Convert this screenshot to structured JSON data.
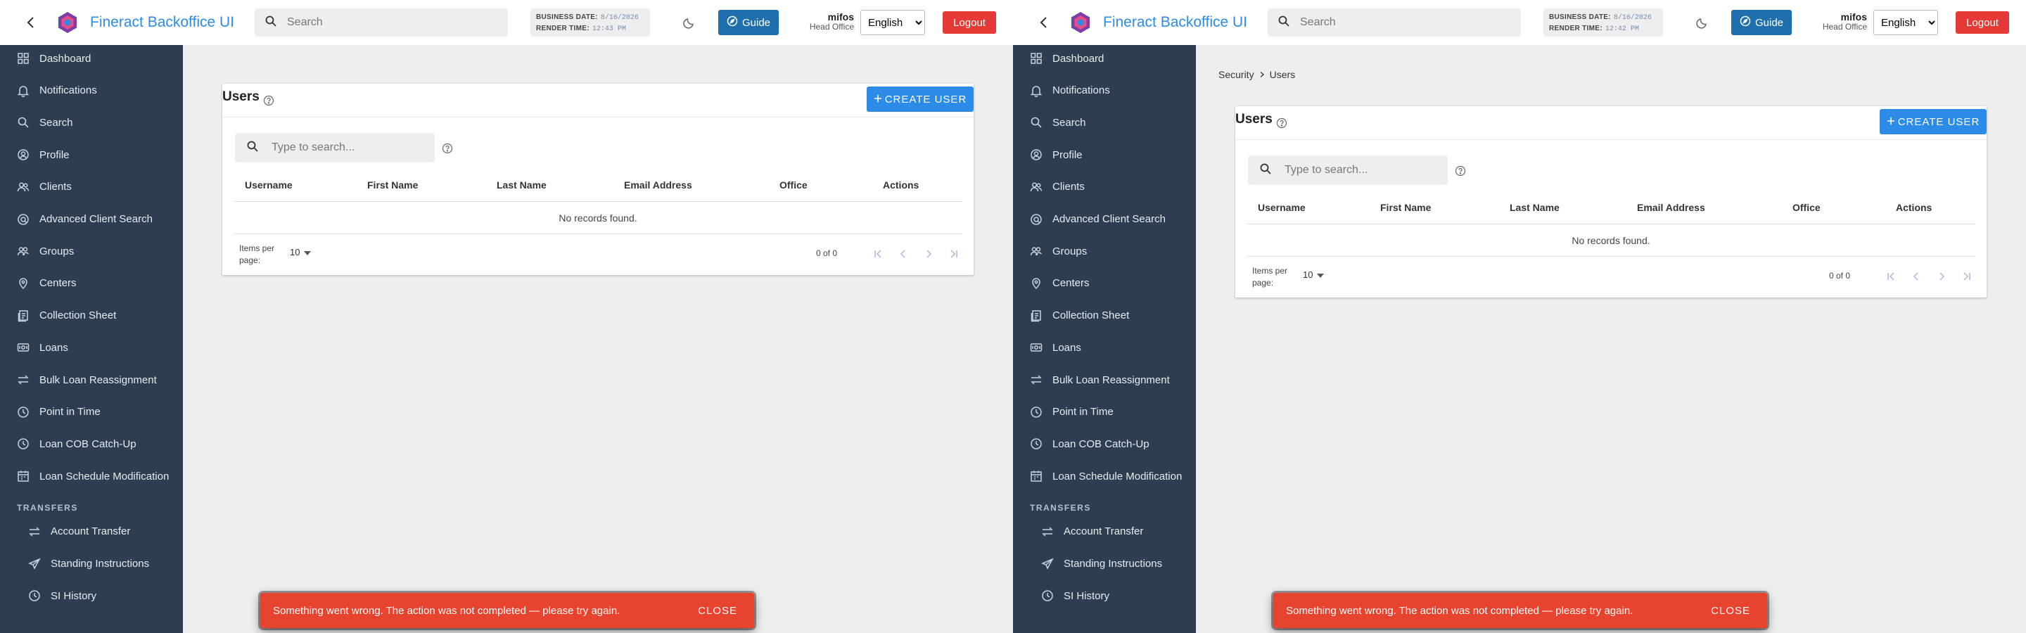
{
  "panes": [
    {
      "topbar": {
        "title": "Fineract Backoffice UI",
        "search_placeholder": "Search",
        "business_date_label": "BUSINESS DATE:",
        "business_date_value": "8/16/2026",
        "render_time_label": "RENDER TIME:",
        "render_time_value": "12:43 PM",
        "guide_label": "Guide",
        "username": "mifos",
        "office": "Head Office",
        "language": "English",
        "logout_label": "Logout"
      },
      "sidebar": {
        "items": [
          "Dashboard",
          "Notifications",
          "Search",
          "Profile",
          "Clients",
          "Advanced Client Search",
          "Groups",
          "Centers",
          "Collection Sheet",
          "Loans",
          "Bulk Loan Reassignment",
          "Point in Time",
          "Loan COB Catch-Up",
          "Loan Schedule Modification"
        ],
        "section_label": "TRANSFERS",
        "sub_items": [
          "Account Transfer",
          "Standing Instructions",
          "SI History"
        ]
      },
      "breadcrumb": null,
      "card": {
        "title": "Users",
        "create_label": "CREATE USER",
        "filter_placeholder": "Type to search...",
        "columns": [
          "Username",
          "First Name",
          "Last Name",
          "Email Address",
          "Office",
          "Actions"
        ],
        "empty_text": "No records found.",
        "items_per_page_label": "Items per page:",
        "items_per_page_value": "10",
        "range_label": "0 of 0"
      },
      "snackbar": {
        "message": "Something went wrong. The action was not completed — please try again.",
        "close_label": "CLOSE"
      }
    },
    {
      "topbar": {
        "title": "Fineract Backoffice UI",
        "search_placeholder": "Search",
        "business_date_label": "BUSINESS DATE:",
        "business_date_value": "8/16/2026",
        "render_time_label": "RENDER TIME:",
        "render_time_value": "12:42 PM",
        "guide_label": "Guide",
        "username": "mifos",
        "office": "Head Office",
        "language": "English",
        "logout_label": "Logout"
      },
      "sidebar": {
        "items": [
          "Dashboard",
          "Notifications",
          "Search",
          "Profile",
          "Clients",
          "Advanced Client Search",
          "Groups",
          "Centers",
          "Collection Sheet",
          "Loans",
          "Bulk Loan Reassignment",
          "Point in Time",
          "Loan COB Catch-Up",
          "Loan Schedule Modification"
        ],
        "section_label": "TRANSFERS",
        "sub_items": [
          "Account Transfer",
          "Standing Instructions",
          "SI History"
        ]
      },
      "breadcrumb": {
        "parent": "Security",
        "current": "Users"
      },
      "card": {
        "title": "Users",
        "create_label": "CREATE USER",
        "filter_placeholder": "Type to search...",
        "columns": [
          "Username",
          "First Name",
          "Last Name",
          "Email Address",
          "Office",
          "Actions"
        ],
        "empty_text": "No records found.",
        "items_per_page_label": "Items per page:",
        "items_per_page_value": "10",
        "range_label": "0 of 0"
      },
      "snackbar": {
        "message": "Something went wrong. The action was not completed — please try again.",
        "close_label": "CLOSE"
      }
    }
  ],
  "colors": {
    "brand": "#2b8be6",
    "sidebar_bg": "#2c3e50",
    "guide_bg": "#1f6fae",
    "logout_bg": "#e53935",
    "snackbar_bg": "#e8432f"
  },
  "icons": {
    "sidebar": [
      "dashboard-icon",
      "bell-icon",
      "search-icon",
      "profile-icon",
      "clients-icon",
      "advanced-search-icon",
      "groups-icon",
      "location-pin-icon",
      "collection-sheet-icon",
      "loans-icon",
      "transfer-arrows-icon",
      "clock-icon",
      "clock-icon",
      "calendar-icon"
    ],
    "sidebar_sub": [
      "transfer-arrows-icon",
      "send-icon",
      "clock-icon"
    ]
  }
}
